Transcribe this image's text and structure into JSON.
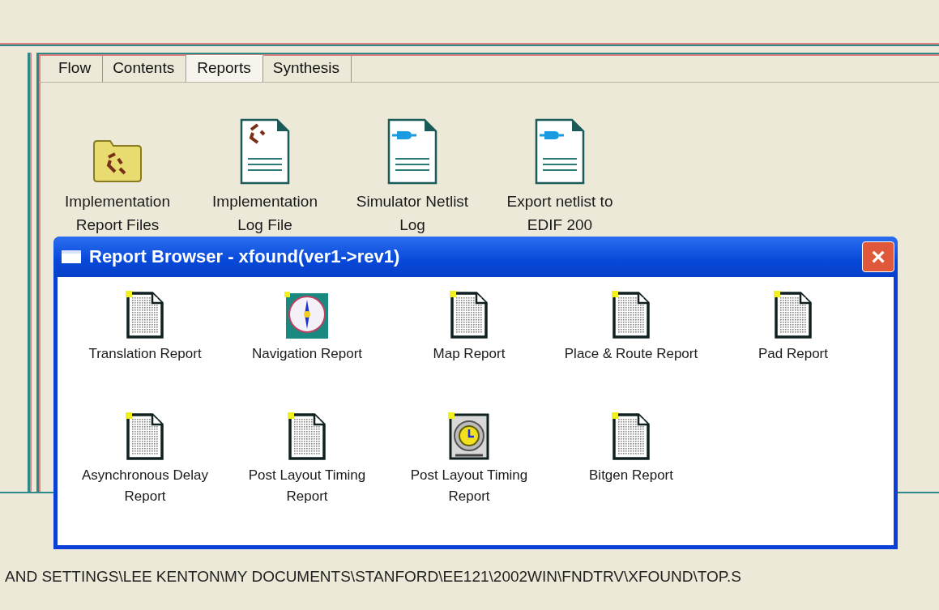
{
  "tabs": [
    {
      "label": "Flow",
      "selected": false
    },
    {
      "label": "Contents",
      "selected": false
    },
    {
      "label": "Reports",
      "selected": true
    },
    {
      "label": "Synthesis",
      "selected": false
    }
  ],
  "processes": [
    {
      "kind": "folder",
      "label": "Implementation Report Files"
    },
    {
      "kind": "log",
      "label": "Implementation Log File"
    },
    {
      "kind": "netlist",
      "label": "Simulator Netlist Log"
    },
    {
      "kind": "netlist",
      "label": "Export netlist to EDIF 200"
    }
  ],
  "dialog": {
    "title": "Report Browser - xfound(ver1->rev1)",
    "close": "×",
    "reports": [
      {
        "kind": "document",
        "label": "Translation Report"
      },
      {
        "kind": "compass",
        "label": "Navigation Report"
      },
      {
        "kind": "document",
        "label": "Map Report"
      },
      {
        "kind": "document",
        "label": "Place & Route Report"
      },
      {
        "kind": "document",
        "label": "Pad Report"
      },
      {
        "kind": "document",
        "label": "Asynchronous Delay Report"
      },
      {
        "kind": "document",
        "label": "Post Layout Timing Report"
      },
      {
        "kind": "stopwatch",
        "label": "Post Layout Timing Report"
      },
      {
        "kind": "document",
        "label": "Bitgen Report"
      }
    ]
  },
  "status_path": "AND SETTINGS\\LEE KENTON\\MY DOCUMENTS\\STANFORD\\EE121\\2002WIN\\FNDTRV\\XFOUND\\TOP.S"
}
